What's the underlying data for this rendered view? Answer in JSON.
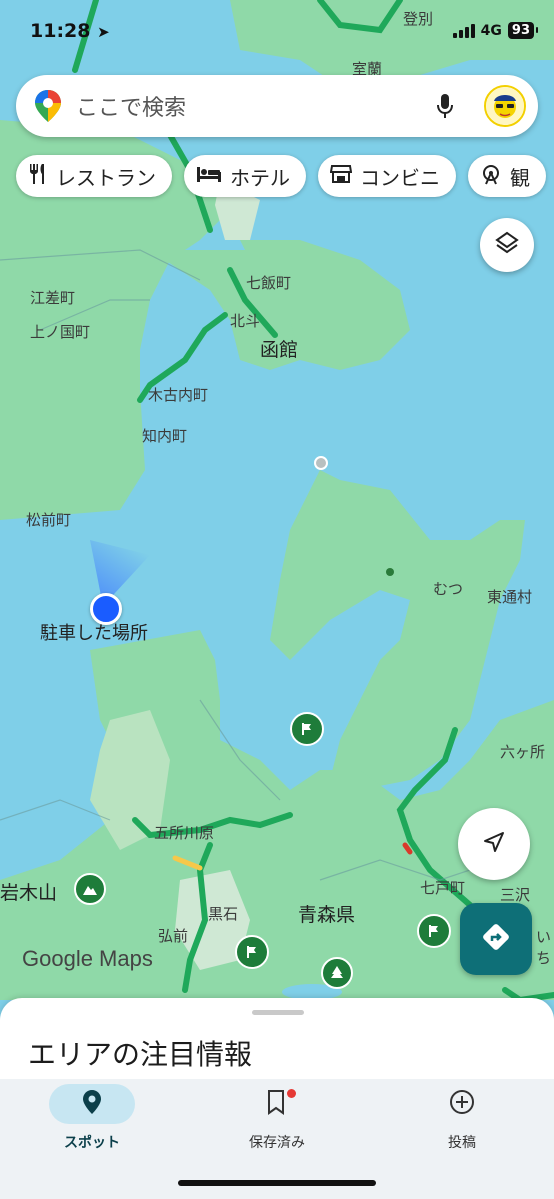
{
  "status_bar": {
    "time": "11:28",
    "network": "4G",
    "battery": "93"
  },
  "search": {
    "placeholder": "ここで検索"
  },
  "chips": [
    {
      "label": "レストラン",
      "icon": "fork-knife-icon"
    },
    {
      "label": "ホテル",
      "icon": "bed-icon"
    },
    {
      "label": "コンビニ",
      "icon": "store-icon"
    },
    {
      "label": "観",
      "icon": "ferris-wheel-icon"
    }
  ],
  "map": {
    "labels": {
      "tobetsu": "登別",
      "muroran": "室蘭",
      "nanae": "七飯町",
      "esashi": "江差町",
      "kaminokuni": "上ノ国町",
      "hokuto": "北斗",
      "hakodate": "函館",
      "kikonai": "木古内町",
      "shiriuchi": "知内町",
      "matsumae": "松前町",
      "parked": "駐車した場所",
      "mutsu": "むつ",
      "higashidori": "東通村",
      "rokkasho": "六ヶ所",
      "goshogawara": "五所川原",
      "iwakiyama": "岩木山",
      "kuroishi": "黒石",
      "aomori": "青森県",
      "hirosaki": "弘前",
      "shichinohe": "七戸町",
      "misawa": "三沢",
      "edge": "いち"
    },
    "logo": "Google Maps"
  },
  "sheet": {
    "title": "エリアの注目情報"
  },
  "tabs": [
    {
      "label": "スポット",
      "icon": "location-pin-icon",
      "active": true
    },
    {
      "label": "保存済み",
      "icon": "bookmark-icon",
      "active": false
    },
    {
      "label": "投稿",
      "icon": "plus-circle-icon",
      "active": false
    }
  ],
  "colors": {
    "water": "#7fcfe8",
    "land": "#8fd9a8",
    "road": "#2ebd6b",
    "accent": "#0e6f77",
    "blue_dot": "#1a5cff"
  }
}
